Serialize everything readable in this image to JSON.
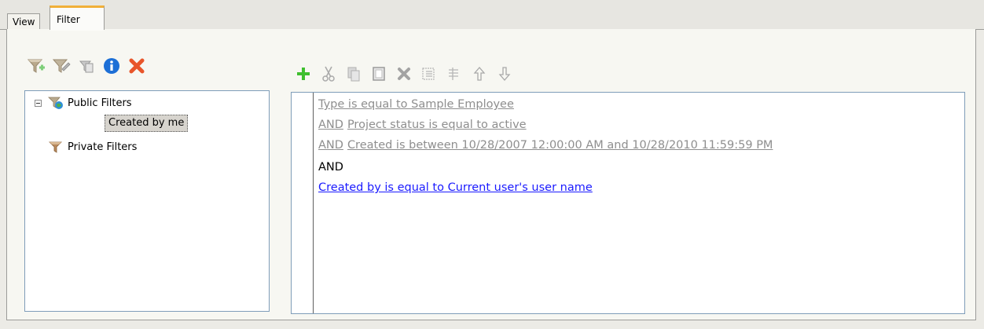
{
  "tabs": [
    {
      "label": "View",
      "active": false
    },
    {
      "label": "Filter",
      "active": true
    }
  ],
  "left_toolbar": {
    "icons": [
      "add-filter-icon",
      "edit-filter-icon",
      "copy-filter-icon",
      "info-icon",
      "delete-icon"
    ]
  },
  "right_toolbar": {
    "icons": [
      "add-icon",
      "cut-icon",
      "copy-icon",
      "paste-icon",
      "delete-icon",
      "group-icon",
      "ungroup-icon",
      "move-up-icon",
      "move-down-icon"
    ]
  },
  "tree": {
    "public_label": "Public Filters",
    "selected_label": "Created by me",
    "private_label": "Private Filters"
  },
  "rules": {
    "line1": "Type is equal to Sample Employee",
    "line2_and": "AND",
    "line2": "Project status is equal to active",
    "line3_and": "AND",
    "line3": "Created is between 10/28/2007 12:00:00 AM and 10/28/2010 11:59:59 PM",
    "line4": "AND",
    "line5": "Created by is equal to Current user's user name"
  },
  "colors": {
    "accent_tab": "#f1b038",
    "link_blue": "#1a1aff",
    "disabled_grey": "#8e8e8e",
    "add_green": "#3fbf2f",
    "delete_orange": "#e8552a",
    "info_blue": "#1d6fd6"
  }
}
